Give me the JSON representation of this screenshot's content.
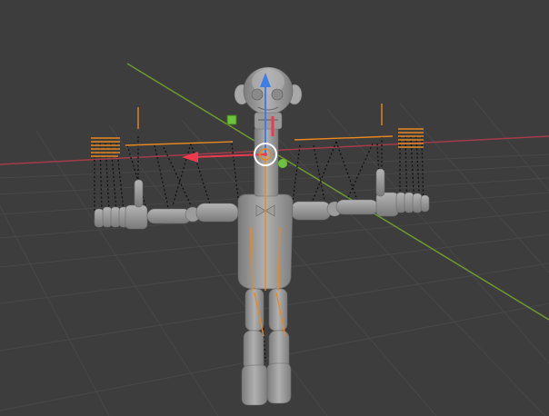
{
  "viewport": {
    "background": "#3d3d3d",
    "grid_color": "#4a4a4a",
    "axis_x_color": "#b04050",
    "axis_y_color": "#6e9a2c",
    "armature_color": "#e8891f",
    "mesh_color": "#9a9a9a",
    "gizmo_x_color": "#ee3a4c",
    "gizmo_y_color": "#8ac93d",
    "gizmo_z_color": "#3f7ee8",
    "object_type": "rigged-puppet-character",
    "pose": "T-pose"
  }
}
